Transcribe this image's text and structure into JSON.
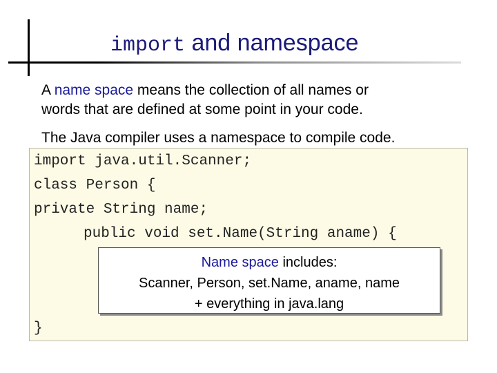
{
  "title": {
    "keyword": "import",
    "rest": "and namespace"
  },
  "paragraph1": {
    "prefix": "A ",
    "highlight": "name space",
    "line1_rest": " means the collection of all names or",
    "line2": "words that are defined at some point in your code."
  },
  "paragraph2": {
    "text": "The Java compiler uses a namespace to compile code."
  },
  "code": {
    "lines": [
      "import java.util.Scanner;",
      "class Person {",
      "private String name;",
      "public void set.Name(String aname) {",
      "}"
    ]
  },
  "callout": {
    "highlight": "Name space",
    "line1_rest": " includes:",
    "line2": "Scanner, Person, set.Name, aname, name",
    "line3": "+ everything in java.lang"
  },
  "colors": {
    "title": "#1a1a7a",
    "highlight": "#1a1a9a",
    "code_background": "#fdfbe6"
  }
}
